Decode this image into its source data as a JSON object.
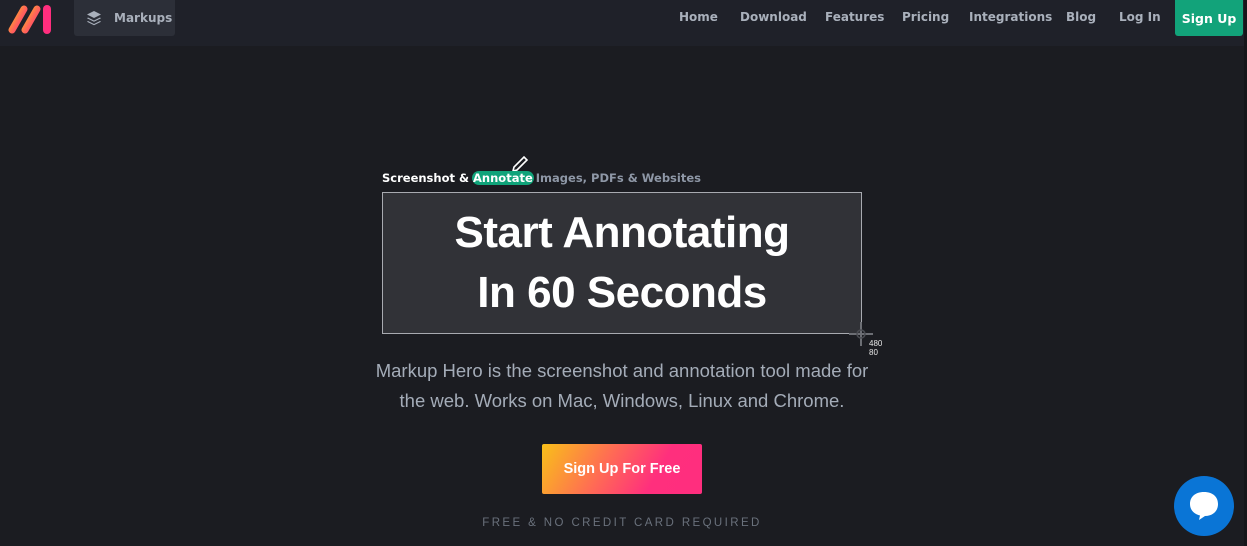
{
  "nav": {
    "logo_alt": "Markup Hero logo",
    "markups_label": "Markups",
    "links": [
      {
        "label": "Home"
      },
      {
        "label": "Download"
      },
      {
        "label": "Features"
      },
      {
        "label": "Pricing"
      },
      {
        "label": "Integrations"
      },
      {
        "label": "Blog"
      },
      {
        "label": "Log In"
      }
    ],
    "signup_label": "Sign Up"
  },
  "hero": {
    "tagline_prefix": "Screenshot &",
    "tagline_highlight": "Annotate",
    "tagline_suffix": "Images, PDFs & Websites",
    "headline_line1": "Start Annotating",
    "headline_line2": "In 60 Seconds",
    "selection_dims": {
      "width": "480",
      "height": "80"
    },
    "description": "Markup Hero is the screenshot and annotation tool made for the web. Works on Mac, Windows, Linux and Chrome.",
    "cta_label": "Sign Up For Free",
    "note": "FREE & NO CREDIT CARD REQUIRED"
  },
  "colors": {
    "background": "#1b1c21",
    "navbar": "#1f2129",
    "accent_green": "#12a37a",
    "chat_blue": "#0a75d6",
    "cta_gradient_start": "#f9c019",
    "cta_gradient_end": "#ff2e7e"
  },
  "icons": {
    "markups": "layers-icon",
    "chat": "chat-bubble-icon",
    "pencil": "pencil-icon",
    "crosshair": "crosshair-icon"
  }
}
